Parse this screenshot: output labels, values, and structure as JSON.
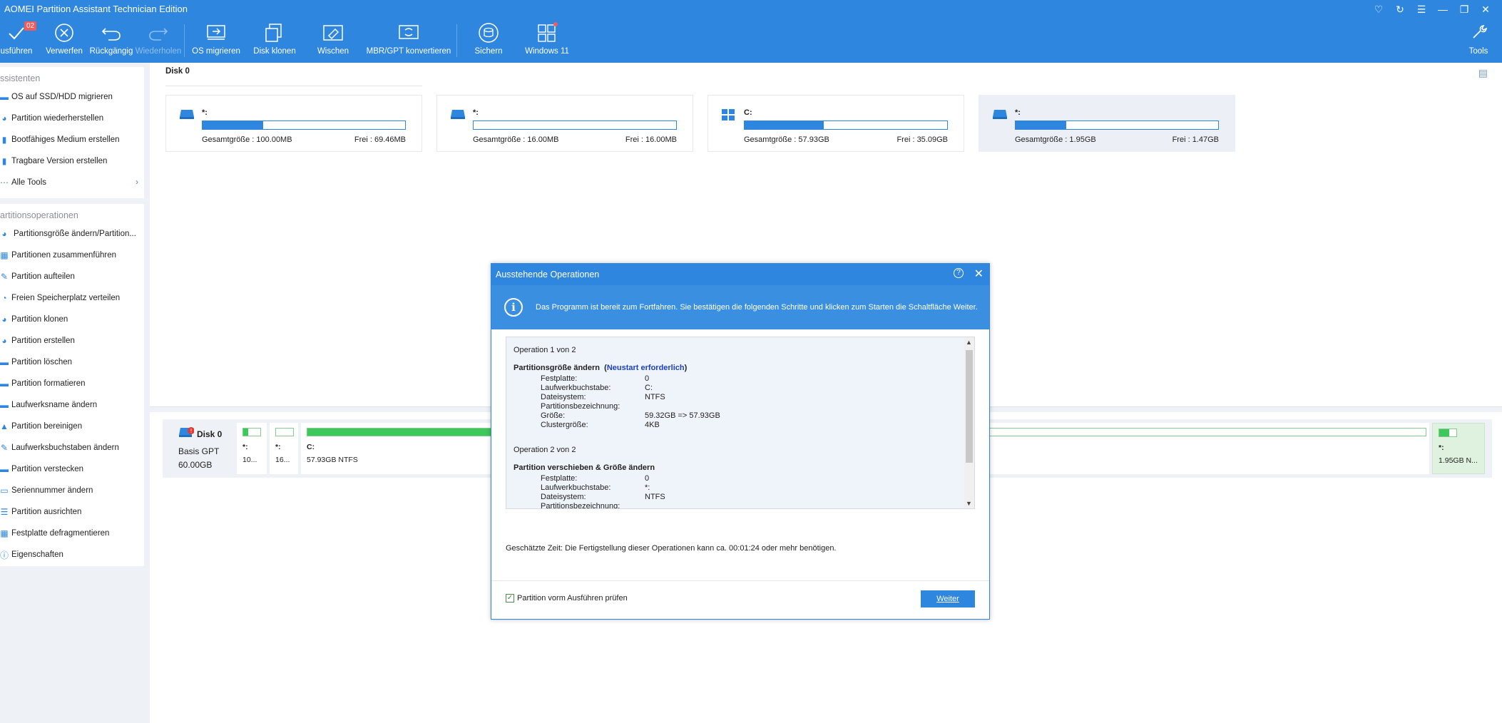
{
  "window": {
    "title": "AOMEI Partition Assistant Technician Edition"
  },
  "toolbar": {
    "apply": {
      "label": "usführen",
      "badge": "02"
    },
    "discard": "Verwerfen",
    "undo": "Rückgängig",
    "redo": "Wiederholen",
    "migrate_os": "OS migrieren",
    "clone_disk": "Disk klonen",
    "wipe": "Wischen",
    "mbr_gpt": "MBR/GPT konvertieren",
    "backup": "Sichern",
    "windows11": "Windows 11",
    "tools": "Tools"
  },
  "sidebar": {
    "wizards_header": "ssistenten",
    "wizards": [
      "OS auf SSD/HDD migrieren",
      "Partition wiederherstellen",
      "Bootfähiges Medium erstellen",
      "Tragbare Version erstellen",
      "Alle Tools"
    ],
    "ops_header": "artitionsoperationen",
    "ops": [
      "Partitionsgröße ändern/Partition...",
      "Partitionen zusammenführen",
      "Partition aufteilen",
      "Freien Speicherplatz verteilen",
      "Partition klonen",
      "Partition erstellen",
      "Partition löschen",
      "Partition formatieren",
      "Laufwerksname ändern",
      "Partition bereinigen",
      "Laufwerksbuchstaben ändern",
      "Partition verstecken",
      "Seriennummer ändern",
      "Partition ausrichten",
      "Festplatte defragmentieren",
      "Eigenschaften"
    ]
  },
  "main": {
    "disk_title": "Disk 0",
    "cards": [
      {
        "name": "*:",
        "total": "Gesamtgröße : 100.00MB",
        "free": "Frei : 69.46MB",
        "used_fraction": 0.3
      },
      {
        "name": "*:",
        "total": "Gesamtgröße : 16.00MB",
        "free": "Frei : 16.00MB",
        "used_fraction": 0.0
      },
      {
        "name": "C:",
        "total": "Gesamtgröße : 57.93GB",
        "free": "Frei : 35.09GB",
        "used_fraction": 0.39
      },
      {
        "name": "*:",
        "total": "Gesamtgröße : 1.95GB",
        "free": "Frei : 1.47GB",
        "used_fraction": 0.25
      }
    ],
    "diskmap": {
      "name": "Disk 0",
      "type": "Basis GPT",
      "size": "60.00GB",
      "parts": [
        {
          "name": "*:",
          "size": "10..."
        },
        {
          "name": "*:",
          "size": "16..."
        },
        {
          "name": "C:",
          "size": "57.93GB NTFS"
        },
        {
          "name": "*:",
          "size": "1.95GB N..."
        }
      ]
    }
  },
  "dialog": {
    "title": "Ausstehende Operationen",
    "info": "Das Programm ist bereit zum Fortfahren. Sie bestätigen die folgenden Schritte und klicken zum Starten die Schaltfläche Weiter.",
    "op1": {
      "header": "Operation 1 von 2",
      "title": "Partitionsgröße ändern",
      "paren_open": "(",
      "link": "Neustart erforderlich",
      "paren_close": ")",
      "rows": [
        {
          "k": "Festplatte:",
          "v": "0"
        },
        {
          "k": "Laufwerkbuchstabe:",
          "v": "C:"
        },
        {
          "k": "Dateisystem:",
          "v": "NTFS"
        },
        {
          "k": "Partitionsbezeichnung:",
          "v": ""
        },
        {
          "k": "Größe:",
          "v": "59.32GB => 57.93GB"
        },
        {
          "k": "Clustergröße:",
          "v": "4KB"
        }
      ]
    },
    "op2": {
      "header": "Operation 2 von 2",
      "title": "Partition verschieben & Größe ändern",
      "rows": [
        {
          "k": "Festplatte:",
          "v": "0"
        },
        {
          "k": "Laufwerkbuchstabe:",
          "v": "*:"
        },
        {
          "k": "Dateisystem:",
          "v": "NTFS"
        },
        {
          "k": "Partitionsbezeichnung:",
          "v": ""
        }
      ]
    },
    "time": "Geschätzte Zeit: Die Fertigstellung dieser Operationen kann ca. 00:01:24 oder mehr benötigen.",
    "check_label": "Partition vorm Ausführen prüfen",
    "next": "Weiter"
  }
}
